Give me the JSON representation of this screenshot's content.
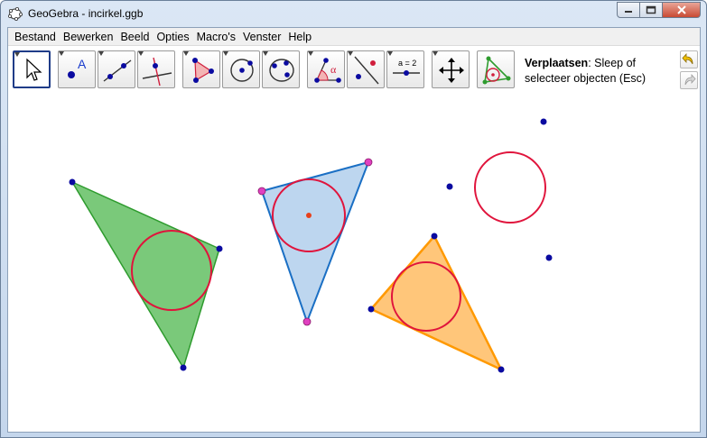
{
  "window": {
    "title": "GeoGebra - incirkel.ggb",
    "icon": "geogebra-ellipse-icon"
  },
  "menu": [
    "Bestand",
    "Bewerken",
    "Beeld",
    "Opties",
    "Macro's",
    "Venster",
    "Help"
  ],
  "toolbar": {
    "tools": [
      {
        "name": "move-tool",
        "icon": "cursor-arrow-icon",
        "selected": true
      },
      {
        "name": "new-point-tool",
        "icon": "point-a-icon"
      },
      {
        "name": "line-tool",
        "icon": "line-through-points-icon"
      },
      {
        "name": "perpendicular-line-tool",
        "icon": "perpendicular-icon"
      },
      {
        "name": "polygon-tool",
        "icon": "polygon-icon"
      },
      {
        "name": "circle-center-point-tool",
        "icon": "circle-center-icon"
      },
      {
        "name": "circle-three-points-tool",
        "icon": "circle-three-points-icon"
      },
      {
        "name": "angle-tool",
        "icon": "angle-icon"
      },
      {
        "name": "reflect-tool",
        "icon": "reflect-icon"
      },
      {
        "name": "slider-tool",
        "icon": "slider-icon",
        "label": "a = 2"
      },
      {
        "name": "move-view-tool",
        "icon": "move-view-icon"
      },
      {
        "name": "incircle-tool",
        "icon": "incircle-triangle-icon"
      }
    ],
    "help_bold": "Verplaatsen",
    "help_text": ": Sleep of selecteer objecten (Esc)"
  },
  "colors": {
    "green_fill": "#6cc36c",
    "green_stroke": "#2e9b2e",
    "blue_fill": "#bdd6ef",
    "blue_stroke": "#1a6fc4",
    "orange_fill": "#ffc67a",
    "orange_stroke": "#ff9900",
    "circle": "#e0143c",
    "point": "#0a0aa0",
    "pink_point": "#e040c0"
  }
}
